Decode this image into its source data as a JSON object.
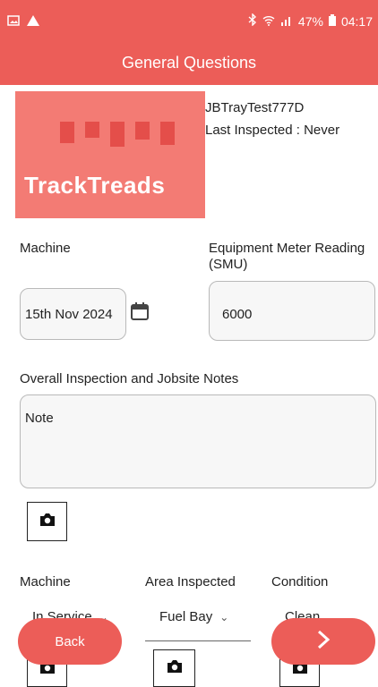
{
  "status_bar": {
    "battery": "47%",
    "time": "04:17"
  },
  "header": {
    "title": "General Questions"
  },
  "logo": {
    "text": "TrackTreads"
  },
  "asset": {
    "id": "JBTrayTest777D",
    "last_inspected": "Last Inspected : Never"
  },
  "machine_section": {
    "label": "Machine",
    "date_value": "15th Nov 2024"
  },
  "meter": {
    "label": "Equipment Meter Reading (SMU)",
    "value": "6000"
  },
  "notes": {
    "label": "Overall Inspection and Jobsite Notes",
    "value": "Note"
  },
  "columns": {
    "machine_label": "Machine",
    "area_label": "Area Inspected",
    "condition_label": "Condition",
    "machine_value": "In Service",
    "area_value": "Fuel Bay",
    "condition_value": "Clean"
  },
  "footer": {
    "back_label": "Back"
  },
  "colors": {
    "accent": "#ec5d58",
    "logo_bg": "#f37b74"
  }
}
